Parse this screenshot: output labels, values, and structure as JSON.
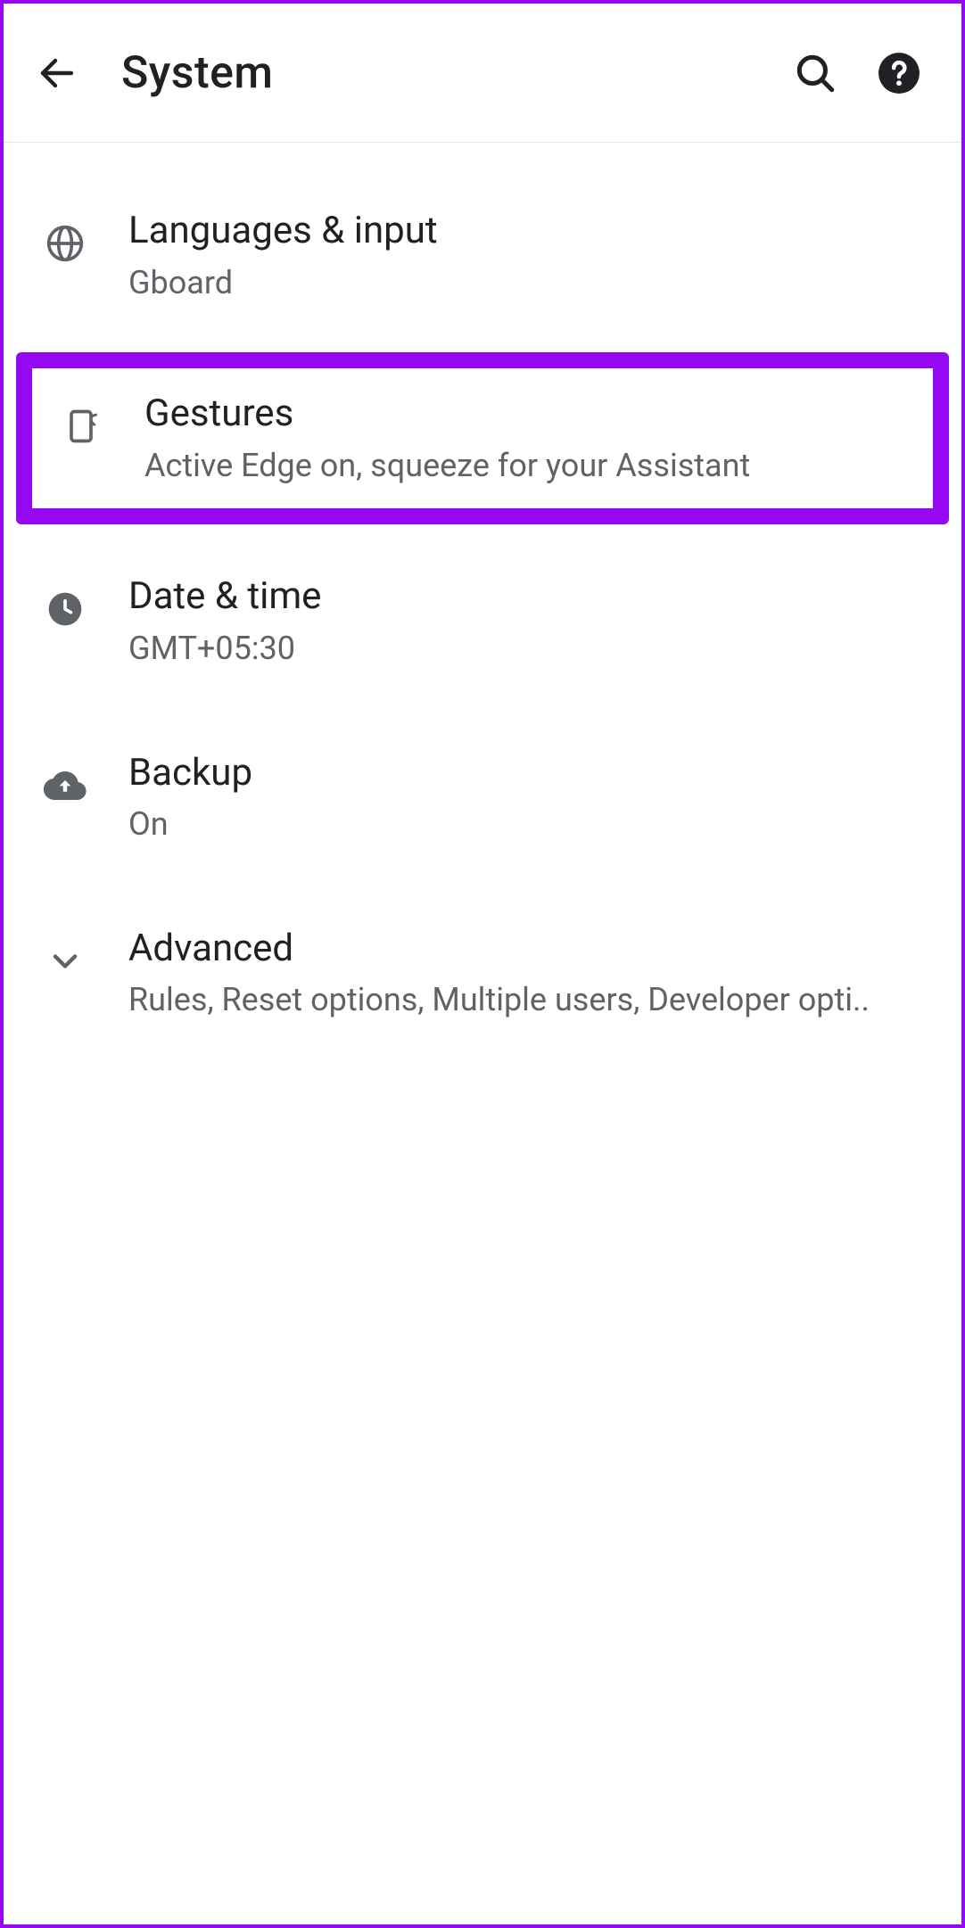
{
  "header": {
    "title": "System"
  },
  "items": [
    {
      "title": "Languages & input",
      "subtitle": "Gboard"
    },
    {
      "title": "Gestures",
      "subtitle": "Active Edge on, squeeze for your Assistant"
    },
    {
      "title": "Date & time",
      "subtitle": "GMT+05:30"
    },
    {
      "title": "Backup",
      "subtitle": "On"
    },
    {
      "title": "Advanced",
      "subtitle": "Rules, Reset options, Multiple users, Developer opti.."
    }
  ]
}
